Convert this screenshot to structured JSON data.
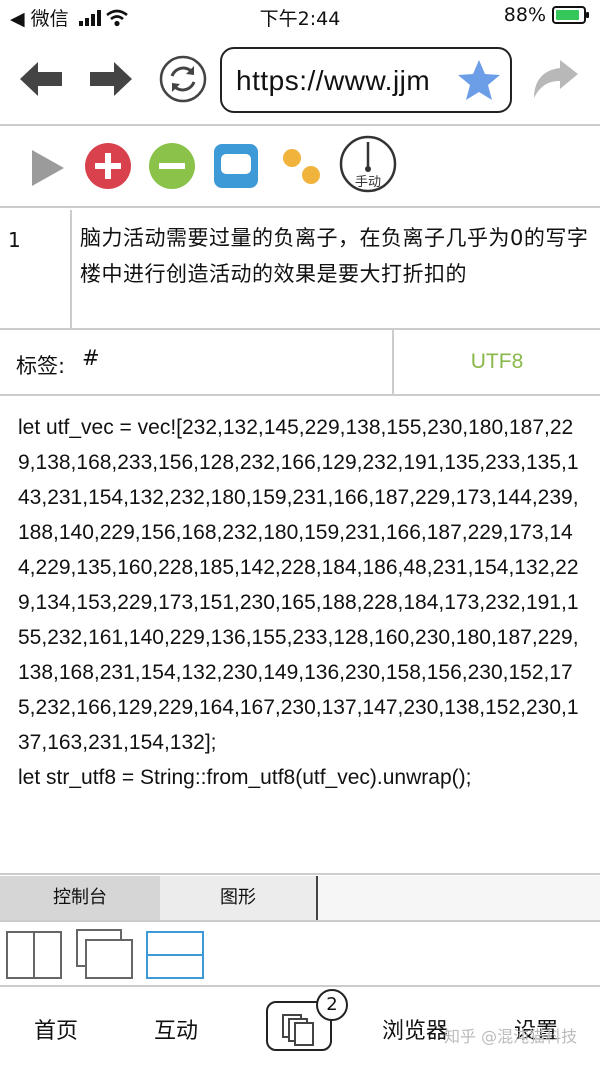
{
  "status_bar": {
    "back_app": "◀ 微信",
    "time": "下午2:44",
    "battery_pct": "88%",
    "battery_level": 0.88
  },
  "nav": {
    "url": "https://www.jjm"
  },
  "row": {
    "number": "1",
    "text": "脑力活动需要过量的负离子，在负离子几乎为0的写字楼中进行创造活动的效果是要大打折扣的"
  },
  "tag": {
    "label": "标签:",
    "value": "#",
    "encoding": "UTF8"
  },
  "code": {
    "line1": "let utf_vec = vec![232,132,145,229,138,155,230,180,187,229,138,168,233,156,128,232,166,129,232,191,135,233,135,143,231,154,132,232,180,159,231,166,187,229,173,144,239,188,140,229,156,168,232,180,159,231,166,187,229,173,144,229,135,160,228,185,142,228,184,186,48,231,154,132,229,134,153,229,173,151,230,165,188,228,184,173,232,191,155,232,161,140,229,136,155,233,128,160,230,180,187,229,138,168,231,154,132,230,149,136,230,158,156,230,152,175,232,166,129,229,164,167,230,137,147,230,138,152,230,137,163,231,154,132];",
    "line2": "let str_utf8 = String::from_utf8(utf_vec).unwrap();"
  },
  "tabs": {
    "console": "控制台",
    "graphics": "图形"
  },
  "bottom_nav": {
    "home": "首页",
    "interact": "互动",
    "tab_count": "2",
    "browser": "浏览器",
    "settings": "设置",
    "watermark": "知乎 @混沌猫科技"
  },
  "colors": {
    "play": "#9b9b9b",
    "add": "#d9414d",
    "remove": "#8bc34a",
    "panel": "#3d9ad6",
    "dots": "#f0b43c",
    "utf8": "#8ab84a",
    "star": "#6c9ee8",
    "battery": "#35c759"
  }
}
